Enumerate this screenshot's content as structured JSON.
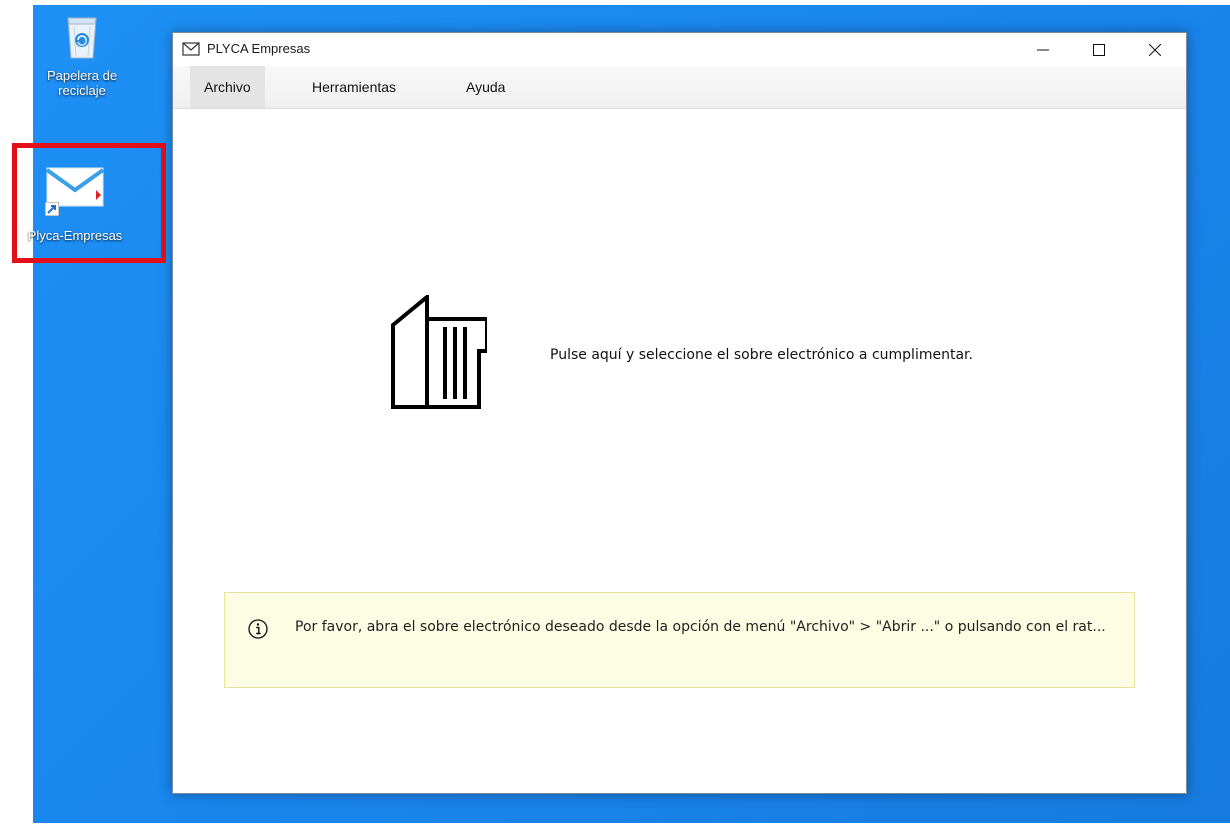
{
  "desktop": {
    "icons": [
      {
        "label": "Papelera de reciclaje",
        "icon": "recycle-bin-icon"
      },
      {
        "label": "Plyca-Empresas",
        "icon": "envelope-shortcut-icon"
      }
    ],
    "highlight_color": "#e3101a"
  },
  "window": {
    "title": "PLYCA Empresas",
    "title_icon": "envelope-icon",
    "controls": [
      "minimize",
      "maximize",
      "close"
    ]
  },
  "menu": {
    "items": [
      {
        "label": "Archivo",
        "active": true
      },
      {
        "label": "Herramientas",
        "active": false
      },
      {
        "label": "Ayuda",
        "active": false
      }
    ]
  },
  "main": {
    "prompt_icon": "open-folder-document-icon",
    "prompt_text": "Pulse aquí y seleccione el sobre electrónico a cumplimentar."
  },
  "info": {
    "icon": "info-icon",
    "text": "Por favor, abra el sobre electrónico deseado desde la opción de menú \"Archivo\" > \"Abrir ...\" o pulsando con el rat..."
  }
}
